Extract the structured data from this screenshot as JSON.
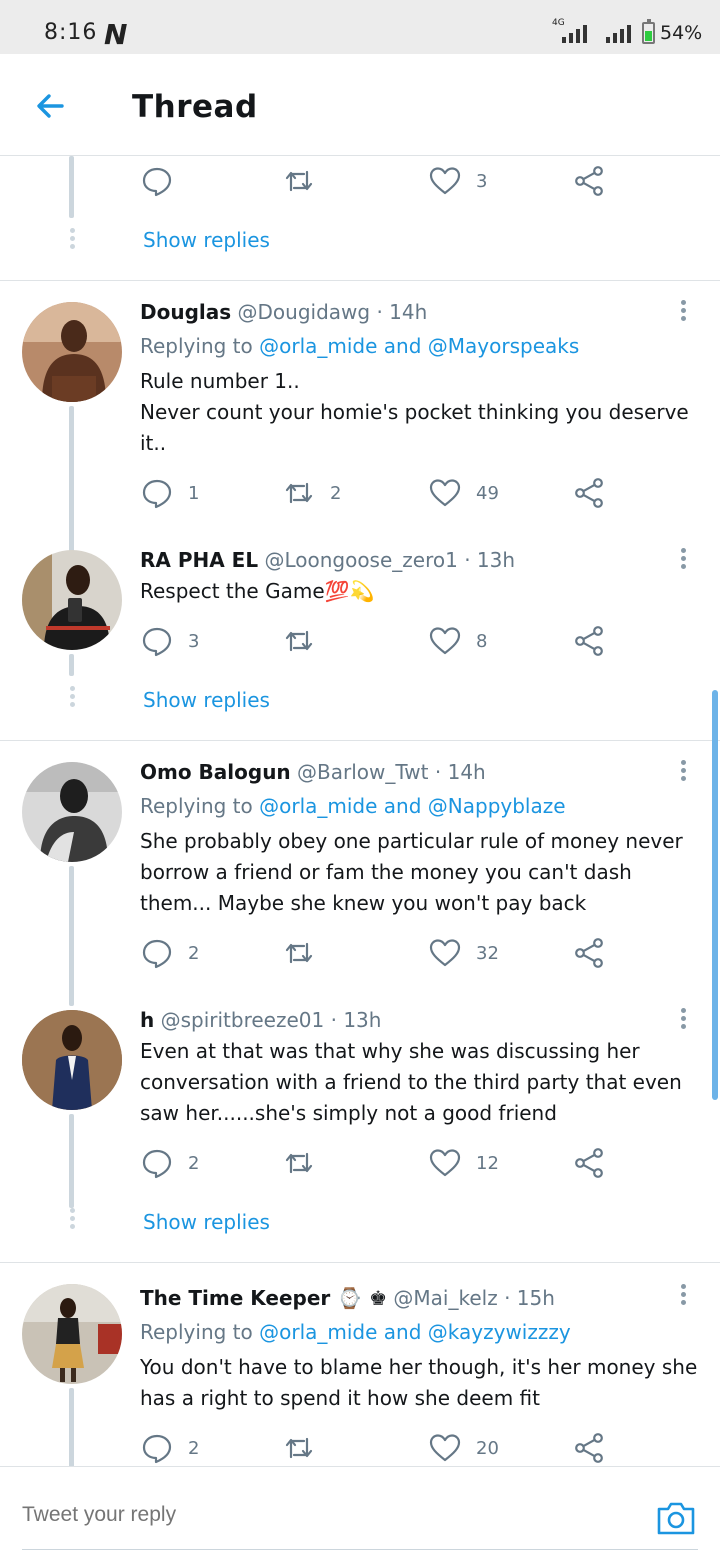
{
  "status_bar": {
    "time": "8:16",
    "carrier_logo": "N",
    "network": "4G",
    "battery": "54%"
  },
  "header": {
    "title": "Thread"
  },
  "top_partial": {
    "likes": "3",
    "show_replies": "Show replies"
  },
  "tweets": [
    {
      "name": "Douglas",
      "handle": "@Dougidawg",
      "time": "14h",
      "replying_prefix": "Replying to",
      "mention1": "@orla_mide",
      "joiner": "and",
      "mention2": "@Mayorspeaks",
      "text1": "Rule number 1..",
      "text2": "Never count your homie's pocket thinking you deserve it..",
      "replies": "1",
      "retweets": "2",
      "likes": "49"
    },
    {
      "name": "RA PHA EL",
      "handle": "@Loongoose_zero1",
      "time": "13h",
      "text": "Respect the Game💯💫",
      "replies": "3",
      "retweets": "",
      "likes": "8",
      "show_replies": "Show replies"
    },
    {
      "name": "Omo Balogun",
      "handle": "@Barlow_Twt",
      "time": "14h",
      "replying_prefix": "Replying to",
      "mention1": "@orla_mide",
      "joiner": "and",
      "mention2": "@Nappyblaze",
      "text": "She probably obey one particular rule of money never borrow a friend or fam the money you can't dash them... Maybe she knew you won't pay back",
      "replies": "2",
      "retweets": "",
      "likes": "32"
    },
    {
      "name": "h",
      "handle": "@spiritbreeze01",
      "time": "13h",
      "text": "Even at that was that why she was discussing her conversation with a friend to the third party that even saw her......she's simply not a good friend",
      "replies": "2",
      "retweets": "",
      "likes": "12",
      "show_replies": "Show replies"
    },
    {
      "name": "The Time Keeper ⌚ ♚",
      "handle": "@Mai_kelz",
      "time": "15h",
      "replying_prefix": "Replying to",
      "mention1": "@orla_mide",
      "joiner": "and",
      "mention2": "@kayzywizzzy",
      "text": "You don't have to blame her though, it's her money she has a right to spend it how she deem fit",
      "replies": "2",
      "retweets": "",
      "likes": "20"
    }
  ],
  "reply_bar": {
    "placeholder": "Tweet your reply"
  },
  "icons": {
    "reply": "reply-icon",
    "retweet": "retweet-icon",
    "like": "heart-icon",
    "share": "share-icon",
    "back": "back-arrow-icon",
    "camera": "camera-icon",
    "more": "more-vertical-icon"
  },
  "colors": {
    "accent": "#1b95e0",
    "text": "#14171a",
    "muted": "#657786",
    "line": "#ccd6dd"
  }
}
